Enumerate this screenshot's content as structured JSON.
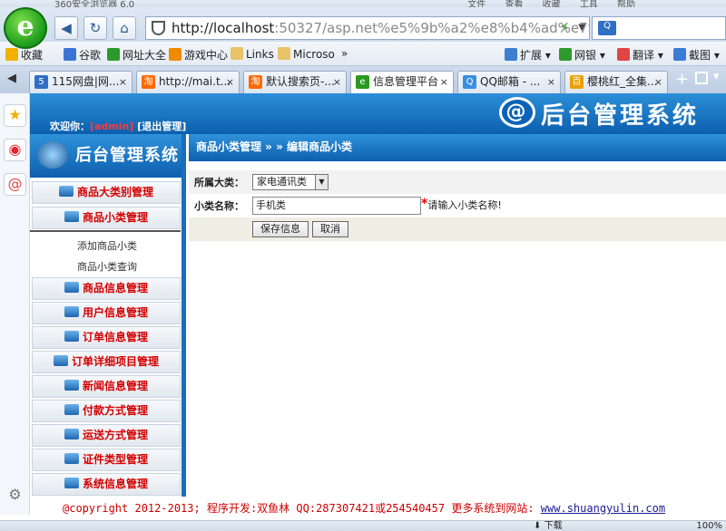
{
  "browser": {
    "title": "360安全浏览器 6.0",
    "menus": [
      "文件",
      "查看",
      "收藏",
      "工具",
      "帮助"
    ],
    "url_host": "http://localhost",
    "url_rest": ":50327/asp.net%e5%9b%a2%e8%b4%ad%e7%bb",
    "search_placeholder": ""
  },
  "bookmarks": {
    "left": [
      {
        "label": "收藏",
        "color": "#f2b100"
      },
      {
        "label": "谷歌",
        "color": "#3b73d6"
      },
      {
        "label": "网址大全",
        "color": "#2b9a2b"
      },
      {
        "label": "游戏中心",
        "color": "#f08a00"
      },
      {
        "label": "Links",
        "color": "#e8c36a"
      },
      {
        "label": "Microso",
        "color": "#e8c36a"
      }
    ],
    "more": "»",
    "right": [
      {
        "label": "扩展",
        "color": "#3c7fd2"
      },
      {
        "label": "网银",
        "color": "#2e9a2e"
      },
      {
        "label": "翻译",
        "color": "#e04545"
      },
      {
        "label": "截图",
        "color": "#3a7bd5"
      }
    ]
  },
  "tabs": [
    {
      "label": "115网盘|网...",
      "badge": "5",
      "color": "#2f6fc4"
    },
    {
      "label": "http://mai.t...",
      "badge": "淘",
      "color": "#ff6a00"
    },
    {
      "label": "默认搜索页-...",
      "badge": "淘",
      "color": "#ff6a00"
    },
    {
      "label": "信息管理平台",
      "badge": "e",
      "color": "#2a9b1f",
      "active": true
    },
    {
      "label": "QQ邮箱 - ...",
      "badge": "Q",
      "color": "#3a8fe0"
    },
    {
      "label": "樱桃红_全集...",
      "badge": "百",
      "color": "#e8a000"
    }
  ],
  "app": {
    "welcome_prefix": "欢迎你：",
    "user": "[admin]",
    "logout": "[退出管理]",
    "banner_title": "后台管理系统",
    "menu_title": "后台管理系统"
  },
  "menu": {
    "item0": "商品大类别管理",
    "item1": "商品小类管理",
    "sub0": "添加商品小类",
    "sub1": "商品小类查询",
    "item2": "商品信息管理",
    "item3": "用户信息管理",
    "item4": "订单信息管理",
    "item5": "订单详细项目管理",
    "item6": "新闻信息管理",
    "item7": "付款方式管理",
    "item8": "运送方式管理",
    "item9": "证件类型管理",
    "item10": "系统信息管理"
  },
  "form": {
    "breadcrumb": "商品小类管理 » » 编辑商品小类",
    "category_label": "所属大类：",
    "category_value": "家电通讯类",
    "name_label": "小类名称：",
    "name_value": "手机类",
    "required_mark": "*",
    "name_hint": "请输入小类名称!",
    "save": "保存信息",
    "cancel": "取消"
  },
  "footer": {
    "text": "@copyright 2012-2013; 程序开发:双鱼林 QQ:287307421或254540457  更多系统到网站:",
    "link": "www.shuangyulin.com"
  },
  "status": {
    "download": "下载",
    "zoom": "100%"
  }
}
